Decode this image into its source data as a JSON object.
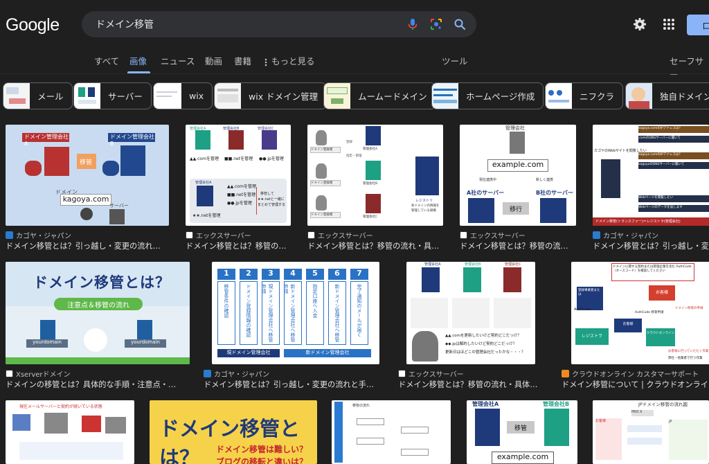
{
  "header": {
    "logo": "Google",
    "search_value": "ドメイン移管",
    "signin_label": "ロ"
  },
  "tabs": [
    {
      "label": "すべて"
    },
    {
      "label": "画像"
    },
    {
      "label": "ニュース"
    },
    {
      "label": "動画"
    },
    {
      "label": "書籍"
    },
    {
      "label": "もっと見る"
    }
  ],
  "tools_label": "ツール",
  "safesearch_label": "セーフサー",
  "chips": [
    {
      "label": "メール"
    },
    {
      "label": "サーバー"
    },
    {
      "label": "wix"
    },
    {
      "label": "wix ドメイン管理"
    },
    {
      "label": "ムームードメイン"
    },
    {
      "label": "ホームページ作成"
    },
    {
      "label": "ニフクラ"
    },
    {
      "label": "独自ドメイン"
    }
  ],
  "results": [
    {
      "source": "カゴヤ・ジャパン",
      "title": "ドメイン移管とは？引っ越し・変更の流れ…",
      "texts": [
        "ドメイン管理会社A",
        "ドメイン管理会社B",
        "移管",
        "ドメイン",
        "kagoya.com",
        "サーバー"
      ]
    },
    {
      "source": "エックスサーバー",
      "title": "ドメイン移管とは？移管の…",
      "texts": [
        "管理会社A",
        "管理会社B",
        "管理会社C",
        "▲▲.comを管理",
        "■■.netを管理",
        "●●.jpを管理",
        "管理会社A",
        "▲▲.comを管理",
        "■■.netを管理",
        "●●.jpを管理",
        "★★.netを管理",
        "移管して",
        "★★.netと一緒に",
        "まとめて管理する"
      ]
    },
    {
      "source": "エックスサーバー",
      "title": "ドメイン移管とは？移管の流れ・具…",
      "texts": [
        "ドメイン登録者",
        "ドメイン登録者",
        "ドメイン登録者",
        "管理会社A",
        "管理会社B",
        "管理会社C",
        "登録",
        "指定・管理",
        "レジストリ",
        "各ドメインの情報を",
        "管理している組織"
      ]
    },
    {
      "source": "エックスサーバー",
      "title": "ドメイン移管とは？移管の流…",
      "texts": [
        "管理会社",
        "example.com",
        "現在連携中",
        "新しく連携",
        "A社のサーバー",
        "B社のサーバー",
        "移行"
      ]
    },
    {
      "source": "カゴヤ・ジャパン",
      "title": "ドメイン移管とは？引っ越し・変",
      "texts": [
        "カゴヤのWebサイトを閲覧したい",
        "kagoya.comのIPアドレスは？",
        ".comのDNSサーバーに聞いて",
        "kagoya.comのIPアドレスは？",
        "kagoyaのDNSサーバーに聞いて",
        "Webページを閲覧したい",
        "Webページのデータを返します",
        "ドメイン移管(トランスファー)＝レジストラ(管理会社)"
      ]
    },
    {
      "source": "Xserverドメイン",
      "title": "ドメインの移管とは？具体的な手順・注意点・…",
      "texts": [
        "ドメイン移管とは？",
        "注意点＆移管の流れ",
        "yourdomain",
        "yourdomain"
      ]
    },
    {
      "source": "カゴヤ・ジャパン",
      "title": "ドメイン移管とは？引っ越し・変更の流れと手…",
      "texts": [
        "1",
        "2",
        "3",
        "4",
        "5",
        "6",
        "7",
        "移管条件の確認",
        "ドメイン登録情報の確認",
        "現ドメイン管理会社へ移管申請",
        "新ドメイン管理会社へ移管申請",
        "指定口座へ入金",
        "新ドメイン管理会社へ移管",
        "完了通知のメールが届く",
        "現ドメイン管理会社",
        "新ドメイン管理会社"
      ]
    },
    {
      "source": "エックスサーバー",
      "title": "ドメイン移管とは？移管の流れ・具体…",
      "texts": [
        "管理会社A",
        "管理会社B",
        "管理会社C",
        "▲▲.comを更新したいけど契約どこだっけ？",
        "◆◆.jpは解約したいけど契約どこだっけ？",
        "更新日はほどこの管理会社だったかな・・・？"
      ]
    },
    {
      "source": "クラウドオンライン カスタマーサポート",
      "title": "ドメイン移管について | クラウドオンライン",
      "texts": [
        "ドメインに関する契約または管理企業を含む AuthCode（オースコード）を確認してください",
        "お客様",
        "登録事業者または",
        "お客様",
        "AuthCode",
        "AuthCode 移管申請",
        "ドメイン移管の申請",
        "レジストラ",
        "クラウドオンライン",
        "お客様に行っていただく作業",
        "弊社・他業者で行う作業"
      ]
    },
    {
      "source": "",
      "title": "",
      "texts": [
        "現在メールサーバーと契約が続いている状態"
      ]
    },
    {
      "source": "",
      "title": "",
      "texts": [
        "ドメイン移管とは？",
        "ドメイン移管は難しい？",
        "ブログの移転と違いは？"
      ]
    },
    {
      "source": "",
      "title": "",
      "texts": [
        "移管の流れ"
      ]
    },
    {
      "source": "",
      "title": "",
      "texts": [
        "管理会社A",
        "管理会社B",
        "移管",
        "example.com"
      ]
    },
    {
      "source": "",
      "title": "",
      "texts": [
        "JPドメイン移管の流れ図",
        "PRO X",
        "お客様",
        "JP"
      ]
    }
  ],
  "colors": {
    "background": "#1f1f1f",
    "accent": "#8ab4f8",
    "text": "#e3e3e3",
    "muted": "#bdc1c6",
    "navy": "#1f3a7a",
    "teal": "#1ea085",
    "maroon": "#8b2a2a",
    "purple": "#4a3a8a"
  },
  "icons": [
    "microphone-icon",
    "lens-icon",
    "search-icon",
    "settings-gear-icon",
    "apps-grid-icon",
    "more-vertical-icon",
    "favicon-kagoya",
    "favicon-xserver"
  ]
}
